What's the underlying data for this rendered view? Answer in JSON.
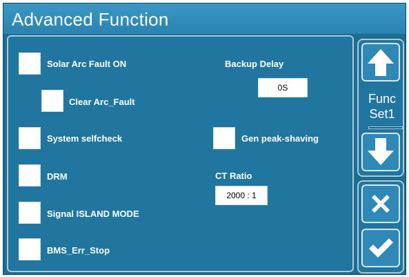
{
  "title": "Advanced Function",
  "options": {
    "solar_arc_fault": {
      "label": "Solar Arc Fault ON",
      "checked": false
    },
    "clear_arc_fault": {
      "label": "Clear Arc_Fault",
      "checked": false
    },
    "system_selfcheck": {
      "label": "System selfcheck",
      "checked": false
    },
    "drm": {
      "label": "DRM",
      "checked": false
    },
    "signal_island": {
      "label": "Signal ISLAND MODE",
      "checked": false
    },
    "bms_err_stop": {
      "label": "BMS_Err_Stop",
      "checked": false
    },
    "gen_peak_shaving": {
      "label": "Gen peak-shaving",
      "checked": false
    }
  },
  "backup_delay": {
    "label": "Backup Delay",
    "value": "0S"
  },
  "ct_ratio": {
    "label": "CT Ratio",
    "value": "2000 : 1"
  },
  "sidebar": {
    "func_line1": "Func",
    "func_line2": "Set1",
    "up_icon": "arrow-up-icon",
    "down_icon": "arrow-down-icon",
    "cancel_icon": "close-icon",
    "confirm_icon": "check-icon"
  },
  "colors": {
    "background": "#2176a0",
    "title_bar": "#2a83b0",
    "checkbox": "#ffffff",
    "text": "#ffffff"
  }
}
